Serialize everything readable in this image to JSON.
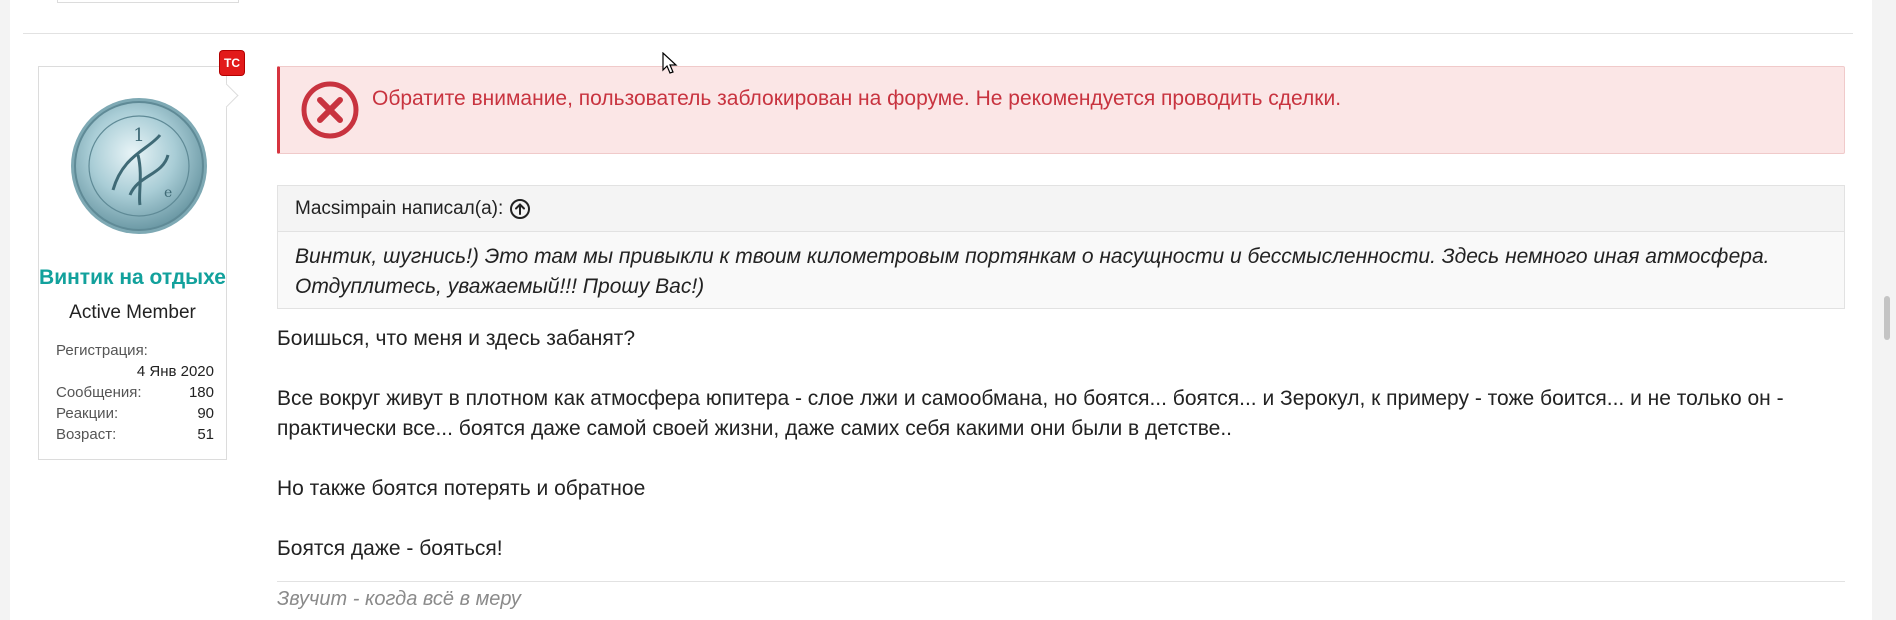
{
  "colors": {
    "username": "#12a19c",
    "alert_text": "#c8333f",
    "alert_bg": "#fbe6e6",
    "badge": "#e21a1a"
  },
  "user": {
    "badge": "ТС",
    "avatar_icon": "coin-avatar-icon",
    "name": "Винтик на отдыхе",
    "title": "Active Member",
    "stats": {
      "reg_label": "Регистрация:",
      "reg_value": "4 Янв 2020",
      "messages_label": "Сообщения:",
      "messages_value": "180",
      "reactions_label": "Реакции:",
      "reactions_value": "90",
      "age_label": "Возраст:",
      "age_value": "51"
    }
  },
  "alert": {
    "icon": "error-x-circle-icon",
    "text": "Обратите внимание, пользователь заблокирован на форуме. Не рекомендуется проводить сделки."
  },
  "quote": {
    "author_line": "Macsimpain написал(а):",
    "jump_icon": "arrow-up-circle-icon",
    "text": "Винтик, шугнись!) Это там мы привыкли к твоим километровым портянкам о насущности и бессмысленности. Здесь немного иная атмосфера. Отдуплитесь, уважаемый!!! Прошу Вас!)"
  },
  "message": {
    "paragraphs": [
      "Боишься, что меня и здесь забанят?",
      "Все вокруг живут в плотном как атмосфера юпитера - слое лжи и самообмана, но боятся... боятся... и Зерокул, к примеру - тоже боится... и не только он - практически все... боятся даже самой своей жизни, даже самих себя какими они были в детстве..",
      "Но также боятся потерять и обратное",
      "Боятся даже - бояться!"
    ]
  },
  "signature": "Звучит - когда всё в меру"
}
